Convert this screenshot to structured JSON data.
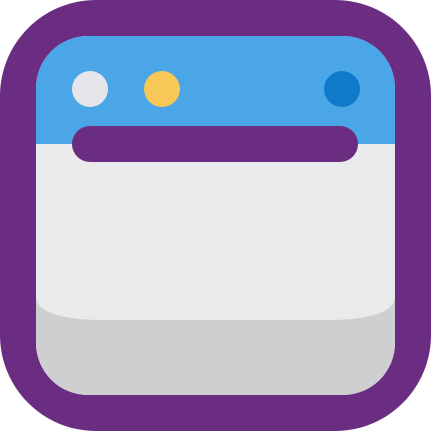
{
  "icon": {
    "name": "browser-window-icon",
    "colors": {
      "frame": "#6B2D82",
      "title_bar": "#4AA6E6",
      "body": "#EAEAEC",
      "footer": "#CFCFD1",
      "address_bar": "#6B2D82",
      "dot_left": "#E6E6EA",
      "dot_middle": "#F7C757",
      "dot_right": "#0F7AC9"
    }
  }
}
